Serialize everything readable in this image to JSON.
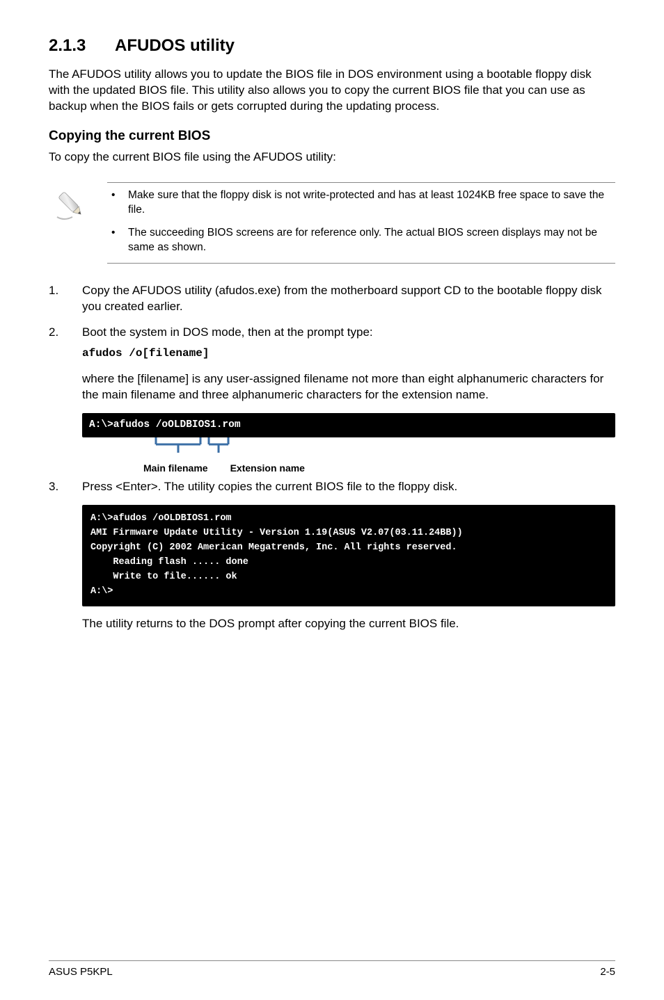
{
  "section": {
    "number": "2.1.3",
    "title": "AFUDOS utility",
    "intro": "The AFUDOS utility allows you to update the BIOS file in DOS environment using a bootable floppy disk with the updated BIOS file. This utility also allows you to copy the current BIOS file that you can use as backup when the BIOS fails or gets corrupted during the updating process."
  },
  "subhead": {
    "title": "Copying the current BIOS",
    "intro": "To copy the current BIOS file using the AFUDOS utility:"
  },
  "notes": {
    "items": [
      "Make sure that the floppy disk is not write-protected and has at least 1024KB free space to save the file.",
      "The succeeding BIOS screens are for reference only. The actual BIOS screen displays may not be same as shown."
    ]
  },
  "steps": {
    "s1": "Copy the AFUDOS utility (afudos.exe) from the motherboard support CD to the bootable floppy disk you created earlier.",
    "s2": "Boot the system in DOS mode, then at the prompt type:",
    "s2_code": "afudos /o[filename]",
    "s2_sub": "where the [filename] is any user-assigned filename not more than eight alphanumeric characters  for the main filename and three alphanumeric characters for the extension name.",
    "s3": "Press <Enter>. The utility copies the current BIOS file to the floppy disk."
  },
  "terminal1": {
    "line": "A:\\>afudos /oOLDBIOS1.rom"
  },
  "diagram": {
    "label_main": "Main filename",
    "label_ext": "Extension name"
  },
  "terminal2": {
    "l1": "A:\\>afudos /oOLDBIOS1.rom",
    "l2": "AMI Firmware Update Utility - Version 1.19(ASUS V2.07(03.11.24BB))",
    "l3": "Copyright (C) 2002 American Megatrends, Inc. All rights reserved.",
    "l4": "    Reading flash ..... done",
    "l5": "    Write to file...... ok",
    "l6": "A:\\>"
  },
  "after": "The utility returns to the DOS prompt after copying the current BIOS file.",
  "footer": {
    "left": "ASUS P5KPL",
    "right": "2-5"
  }
}
